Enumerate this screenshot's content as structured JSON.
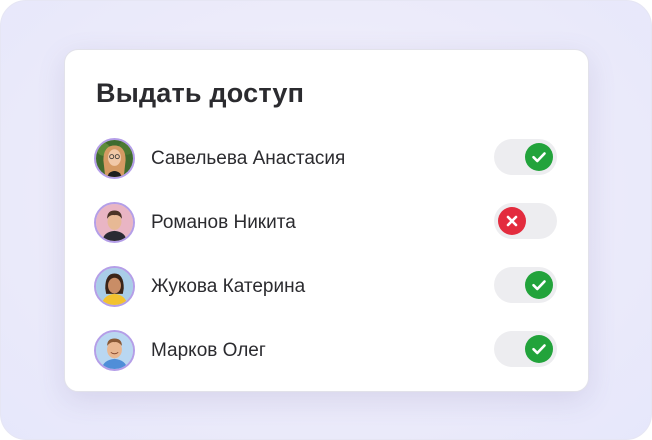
{
  "title": "Выдать доступ",
  "users": [
    {
      "name": "Савельева Анастасия",
      "access": true,
      "avatar_icon": "woman-glasses-avatar-icon"
    },
    {
      "name": "Романов Никита",
      "access": false,
      "avatar_icon": "man-avatar-icon"
    },
    {
      "name": "Жукова Катерина",
      "access": true,
      "avatar_icon": "woman-yellow-avatar-icon"
    },
    {
      "name": "Марков Олег",
      "access": true,
      "avatar_icon": "man-smiling-avatar-icon"
    }
  ],
  "colors": {
    "on": "#22a33b",
    "off": "#e32c3e",
    "avatar_ring": "#b49ee8"
  }
}
